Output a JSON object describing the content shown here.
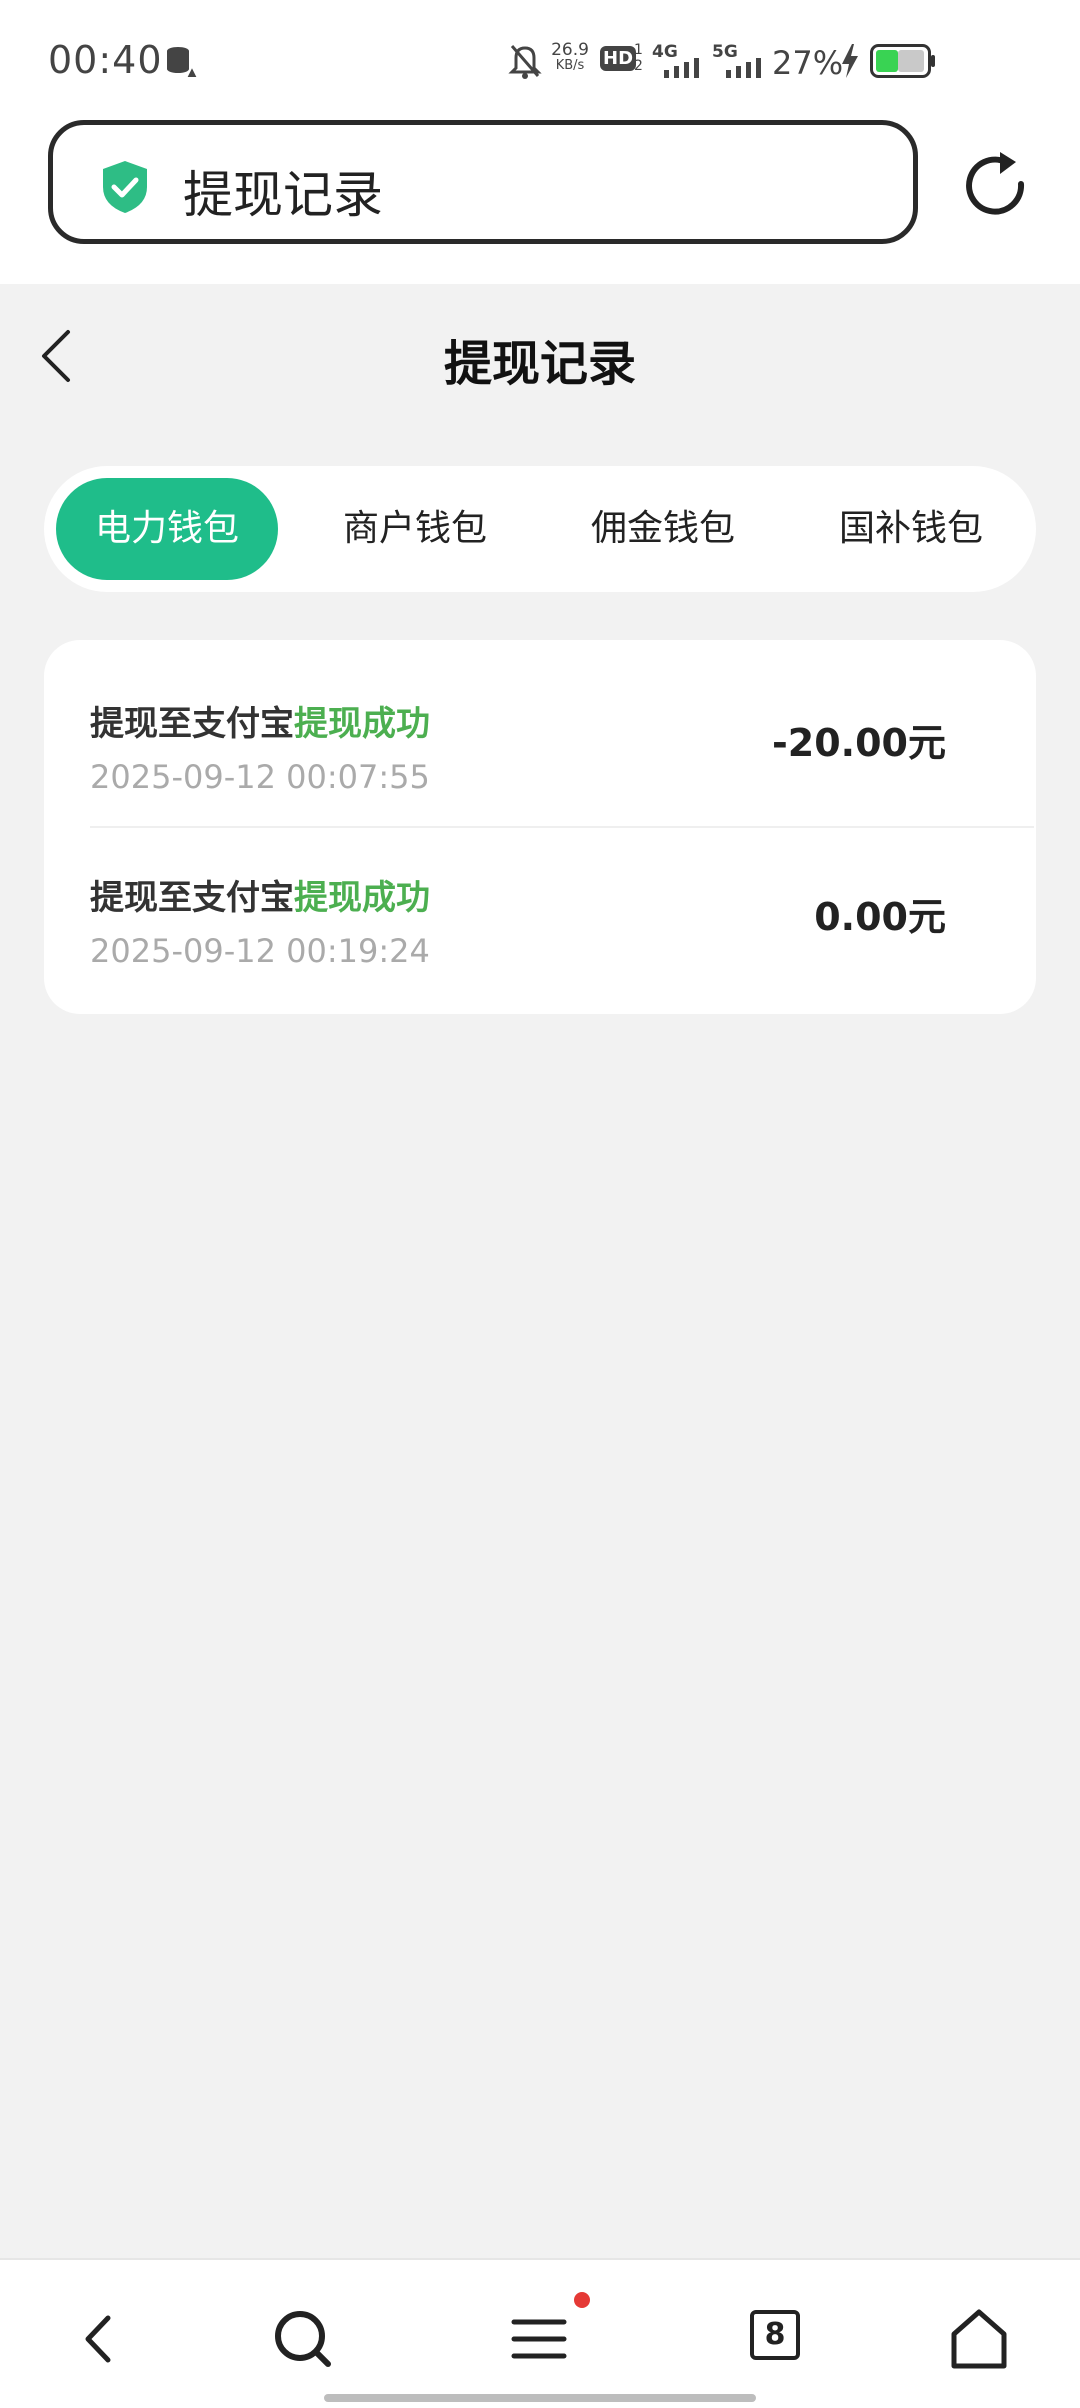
{
  "status_bar": {
    "time": "00:40",
    "net_speed_value": "26.9",
    "net_speed_unit": "KB/s",
    "hd_label": "HD",
    "hd_sub_top": "1",
    "hd_sub_bottom": "2",
    "sig1": "4G",
    "sig2": "5G",
    "battery": "27%"
  },
  "browser": {
    "address_text": "提现记录",
    "tab_count": "8"
  },
  "header": {
    "title": "提现记录"
  },
  "tabs": [
    {
      "label": "电力钱包",
      "active": true
    },
    {
      "label": "商户钱包",
      "active": false
    },
    {
      "label": "佣金钱包",
      "active": false
    },
    {
      "label": "国补钱包",
      "active": false
    }
  ],
  "records": [
    {
      "title": "提现至支付宝",
      "status": "提现成功",
      "datetime": "2025-09-12 00:07:55",
      "amount": "-20.00元"
    },
    {
      "title": "提现至支付宝",
      "status": "提现成功",
      "datetime": "2025-09-12 00:19:24",
      "amount": "0.00元"
    }
  ],
  "colors": {
    "accent": "#1fbd8a",
    "success_text": "#4caf50",
    "shield": "#2ebd85",
    "notification_dot": "#e53935"
  }
}
